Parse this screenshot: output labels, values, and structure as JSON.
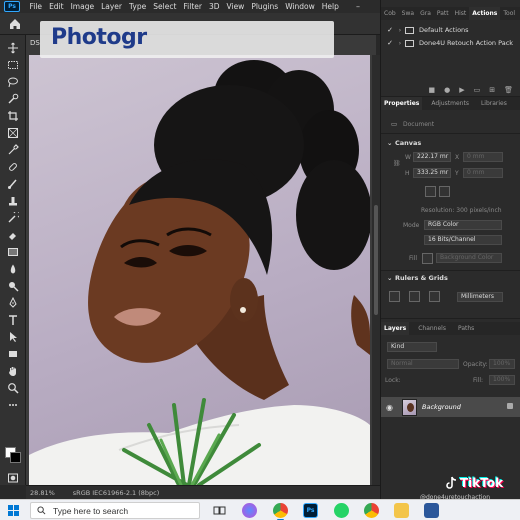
{
  "menubar": {
    "app_logo": "Ps",
    "items": [
      "File",
      "Edit",
      "Image",
      "Layer",
      "Type",
      "Select",
      "Filter",
      "3D",
      "View",
      "Plugins",
      "Window",
      "Help"
    ]
  },
  "overlay": {
    "title": "Photogr"
  },
  "document": {
    "tab_label": "DS"
  },
  "status": {
    "zoom": "28.81%",
    "profile": "sRGB IEC61966-2.1 (8bpc)"
  },
  "actions_panel": {
    "tabs": [
      "Cob",
      "Swa",
      "Gra",
      "Patt",
      "Hist",
      "Actions",
      "Tool"
    ],
    "active_tab": "Actions",
    "items": [
      {
        "label": "Default Actions"
      },
      {
        "label": "Done4U Retouch Action Pack"
      }
    ]
  },
  "properties_panel": {
    "tabs": [
      "Properties",
      "Adjustments",
      "Libraries"
    ],
    "active_tab": "Properties",
    "document_label": "Document",
    "canvas_section": "Canvas",
    "width_label": "W",
    "width_value": "222.17 mr",
    "height_label": "H",
    "height_value": "333.25 mr",
    "x_value": "0 mm",
    "y_value": "0 mm",
    "resolution": "Resolution: 300 pixels/inch",
    "mode_label": "Mode",
    "mode_value": "RGB Color",
    "depth_value": "16 Bits/Channel",
    "fill_label": "Fill",
    "fill_value": "Background Color",
    "rulers_section": "Rulers & Grids",
    "units_value": "Millimeters"
  },
  "layers_panel": {
    "tabs": [
      "Layers",
      "Channels",
      "Paths"
    ],
    "active_tab": "Layers",
    "kind_label": "Kind",
    "blend_mode": "Normal",
    "opacity_label": "Opacity:",
    "opacity_value": "100%",
    "lock_label": "Lock:",
    "fill_label": "Fill:",
    "fill_value": "100%",
    "layers": [
      {
        "name": "Background"
      }
    ]
  },
  "watermark": {
    "brand": "TikTok",
    "handle": "@done4uretouchaction"
  },
  "taskbar": {
    "search_placeholder": "Type here to search"
  },
  "colors": {
    "accent": "#31a8ff",
    "title_text": "#1f3b8a",
    "panel_bg": "#2b2b2b",
    "taskbar_bg": "#eef0f4"
  }
}
